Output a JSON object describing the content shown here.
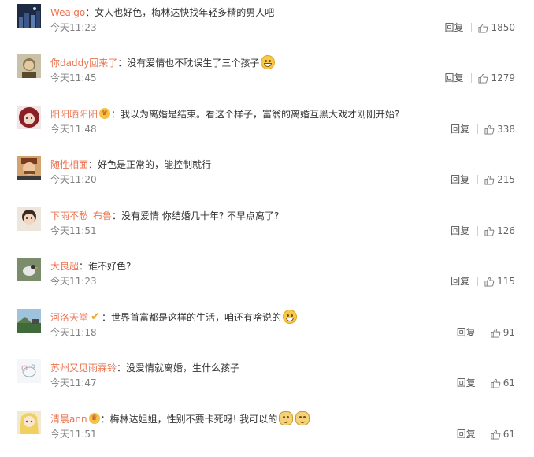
{
  "separator": "：",
  "reply_label": "回复",
  "colors": {
    "username": "#eb7350",
    "meta": "#808080",
    "text": "#333333"
  },
  "comments": [
    {
      "username": "Wealgo",
      "badge": null,
      "text": "女人也好色，梅林达快找年轻多精的男人吧",
      "emojis": [],
      "time": "今天11:23",
      "likes": "1850",
      "avatar_icon": "dark-city-avatar"
    },
    {
      "username": "你daddy回来了",
      "badge": null,
      "text": "没有爱情也不耽误生了三个孩子",
      "emojis": [
        "grin-emoji"
      ],
      "time": "今天11:45",
      "likes": "1279",
      "avatar_icon": "portrait-avatar"
    },
    {
      "username": "阳阳晒阳阳",
      "badge": "crown-badge",
      "text": "我以为离婚是结束。看这个样子，富翁的离婚互黑大戏才刚刚开始?",
      "emojis": [],
      "time": "今天11:48",
      "likes": "338",
      "avatar_icon": "red-hat-avatar"
    },
    {
      "username": "随性相面",
      "badge": null,
      "text": "好色是正常的，能控制就行",
      "emojis": [],
      "time": "今天11:20",
      "likes": "215",
      "avatar_icon": "man-avatar"
    },
    {
      "username": "下雨不愁_布鲁",
      "badge": null,
      "text": "没有爱情 你结婚几十年? 不早点离了?",
      "emojis": [],
      "time": "今天11:51",
      "likes": "126",
      "avatar_icon": "child-avatar"
    },
    {
      "username": "大良超",
      "badge": null,
      "text": "谁不好色?",
      "emojis": [],
      "time": "今天11:23",
      "likes": "115",
      "avatar_icon": "bird-avatar"
    },
    {
      "username": "河洛天堂",
      "badge": "v-badge",
      "text": "世界首富都是这样的生活，咱还有啥说的",
      "emojis": [
        "grin-emoji"
      ],
      "time": "今天11:18",
      "likes": "91",
      "avatar_icon": "landscape-avatar"
    },
    {
      "username": "苏州又见雨霖铃",
      "badge": null,
      "text": "没爱情就离婚，生什么孩子",
      "emojis": [],
      "time": "今天11:47",
      "likes": "61",
      "avatar_icon": "sketch-avatar"
    },
    {
      "username": "清晨ann",
      "badge": "crown-badge",
      "text": "梅林达姐姐，性别不要卡死呀! 我可以的",
      "emojis": [
        "cat-emoji",
        "cat-emoji"
      ],
      "time": "今天11:51",
      "likes": "61",
      "avatar_icon": "anime-girl-avatar"
    }
  ]
}
